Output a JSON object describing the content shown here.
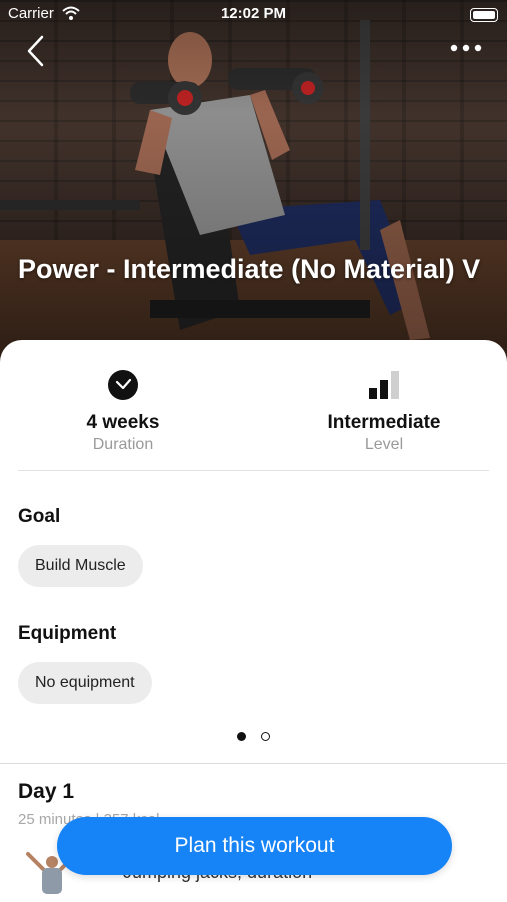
{
  "status_bar": {
    "carrier": "Carrier",
    "time": "12:02 PM"
  },
  "header": {
    "title": "Power - Intermediate (No Material) V"
  },
  "stats": {
    "duration": {
      "value": "4 weeks",
      "label": "Duration",
      "icon": "clock-icon"
    },
    "level": {
      "value": "Intermediate",
      "label": "Level",
      "icon": "level-bars-icon"
    }
  },
  "goal": {
    "title": "Goal",
    "chip": "Build Muscle"
  },
  "equipment": {
    "title": "Equipment",
    "chip": "No equipment"
  },
  "pager": {
    "pages": 2,
    "active": 1
  },
  "day": {
    "title": "Day 1",
    "subtitle": "25 minutes | 357 kcal",
    "first_exercise": "Jumping jacks, duration"
  },
  "cta": {
    "label": "Plan this workout",
    "color": "#1683f7"
  }
}
